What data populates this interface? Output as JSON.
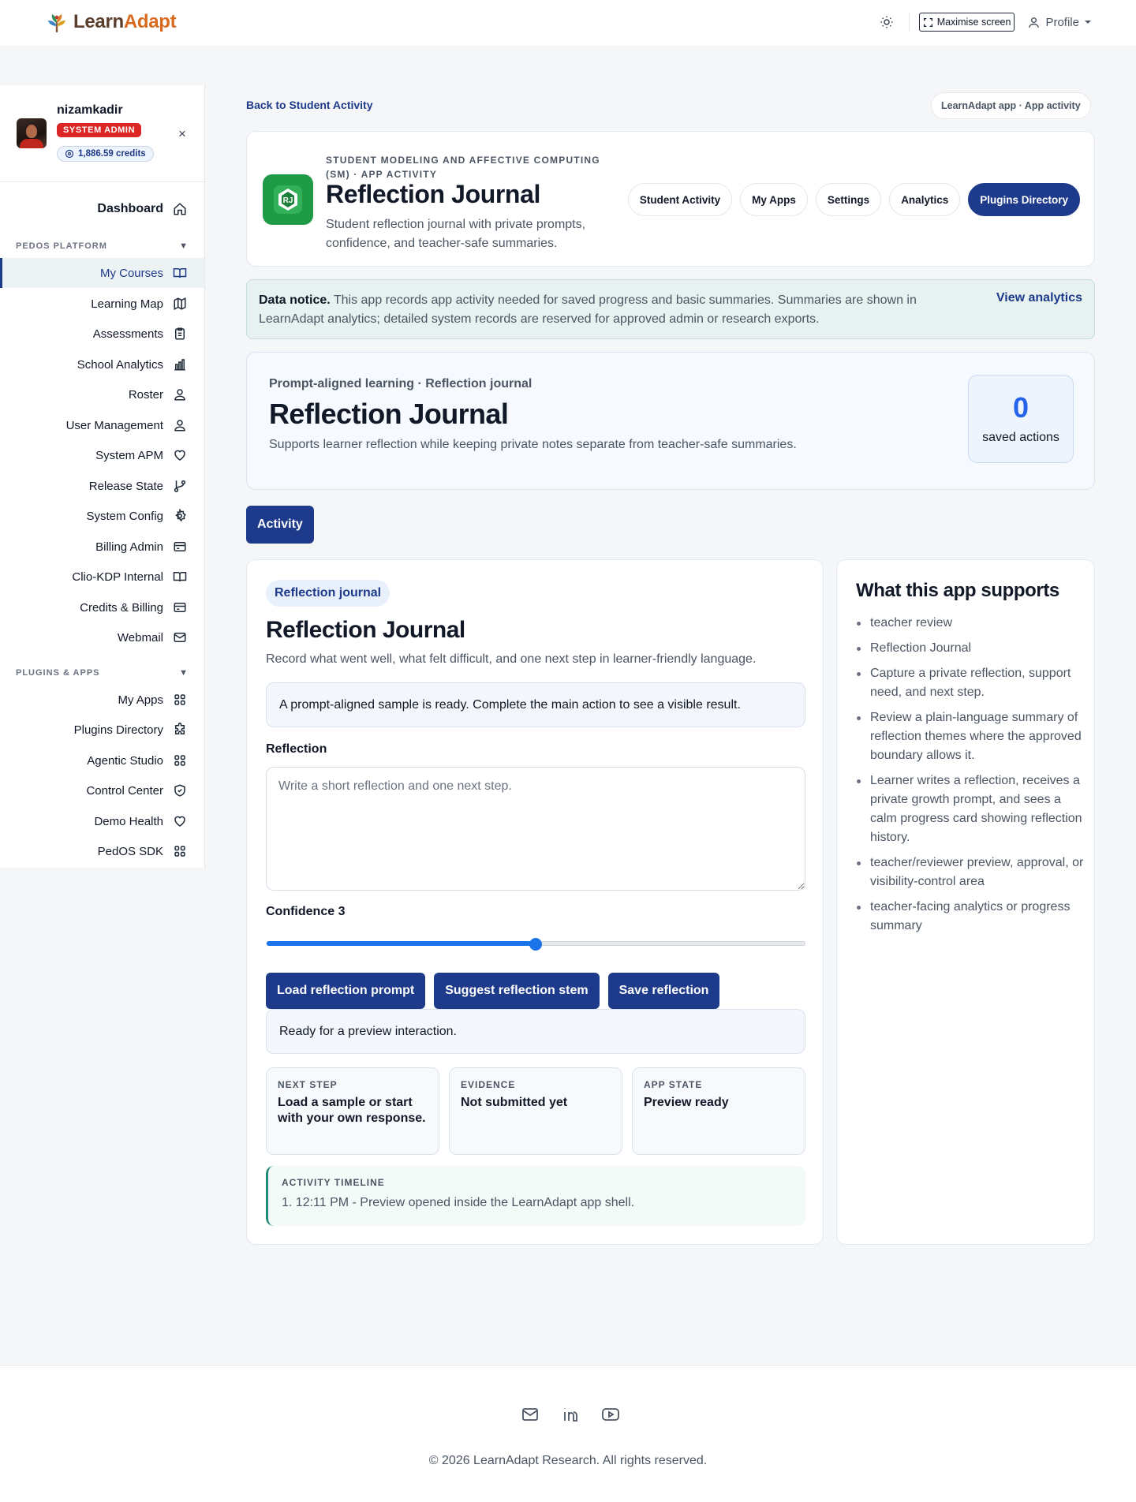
{
  "brand": {
    "name_part1": "Learn",
    "name_part2": "Adapt"
  },
  "topbar": {
    "theme_icon": "sun-icon",
    "maximise_label": "Maximise screen",
    "profile_label": "Profile"
  },
  "user": {
    "name": "nizamkadir",
    "role": "SYSTEM ADMIN",
    "credits": "1,886.59 credits",
    "close_glyph": "×"
  },
  "sidebar": {
    "dashboard": {
      "label": "Dashboard",
      "icon": "home-icon"
    },
    "sections": [
      {
        "title": "PEDOS PLATFORM",
        "caret": "▼"
      },
      {
        "title": "PLUGINS & APPS",
        "caret": "▼"
      }
    ],
    "platform_items": [
      {
        "label": "My Courses",
        "icon": "book-open-icon",
        "active": true
      },
      {
        "label": "Learning Map",
        "icon": "map-icon"
      },
      {
        "label": "Assessments",
        "icon": "clipboard-icon"
      },
      {
        "label": "School Analytics",
        "icon": "bar-chart-icon"
      },
      {
        "label": "Roster",
        "icon": "users-icon"
      },
      {
        "label": "User Management",
        "icon": "users-icon"
      },
      {
        "label": "System APM",
        "icon": "heart-icon"
      },
      {
        "label": "Release State",
        "icon": "git-branch-icon"
      },
      {
        "label": "System Config",
        "icon": "settings-icon"
      },
      {
        "label": "Billing Admin",
        "icon": "credit-card-icon"
      },
      {
        "label": "Clio-KDP Internal",
        "icon": "book-open-icon"
      },
      {
        "label": "Credits & Billing",
        "icon": "credit-card-icon"
      },
      {
        "label": "Webmail",
        "icon": "mail-icon"
      }
    ],
    "plugin_items": [
      {
        "label": "My Apps",
        "icon": "grid-icon"
      },
      {
        "label": "Plugins Directory",
        "icon": "puzzle-icon"
      },
      {
        "label": "Agentic Studio",
        "icon": "grid-icon"
      },
      {
        "label": "Control Center",
        "icon": "shield-icon"
      },
      {
        "label": "Demo Health",
        "icon": "heart-icon"
      },
      {
        "label": "PedOS SDK",
        "icon": "grid-icon"
      }
    ]
  },
  "breadcrumb": {
    "back": "Back to Student Activity",
    "context": "LearnAdapt app · App activity"
  },
  "app": {
    "logo_initials": "RJ",
    "category": "STUDENT MODELING AND AFFECTIVE COMPUTING (SM) · APP ACTIVITY",
    "title": "Reflection Journal",
    "description": "Student reflection journal with private prompts, confidence, and teacher-safe summaries.",
    "nav": [
      "Student Activity",
      "My Apps",
      "Settings",
      "Analytics",
      "Plugins Directory"
    ]
  },
  "notice": {
    "label": "Data notice.",
    "text": "This app records app activity needed for saved progress and basic summaries. Summaries are shown in LearnAdapt analytics; detailed system records are reserved for approved admin or research exports.",
    "link": "View analytics"
  },
  "hero": {
    "eyebrow": "Prompt-aligned learning · Reflection journal",
    "title": "Reflection Journal",
    "description": "Supports learner reflection while keeping private notes separate from teacher-safe summaries.",
    "stat_value": "0",
    "stat_label": "saved actions"
  },
  "tabs": {
    "activity": "Activity"
  },
  "activity": {
    "tag": "Reflection journal",
    "title": "Reflection Journal",
    "description": "Record what went well, what felt difficult, and one next step in learner-friendly language.",
    "sample_notice": "A prompt-aligned sample is ready. Complete the main action to see a visible result.",
    "reflection_label": "Reflection",
    "reflection_value": "",
    "reflection_placeholder": "Write a short reflection and one next step.",
    "confidence_label": "Confidence 3",
    "confidence_value": 3,
    "confidence_min": 1,
    "confidence_max": 5,
    "buttons": [
      "Load reflection prompt",
      "Suggest reflection stem",
      "Save reflection"
    ],
    "status": "Ready for a preview interaction.",
    "tiles": [
      {
        "label": "NEXT STEP",
        "value": "Load a sample or start with your own response."
      },
      {
        "label": "EVIDENCE",
        "value": "Not submitted yet"
      },
      {
        "label": "APP STATE",
        "value": "Preview ready"
      }
    ],
    "timeline_label": "ACTIVITY TIMELINE",
    "timeline": [
      "1. 12:11 PM - Preview opened inside the LearnAdapt app shell."
    ]
  },
  "supports": {
    "title": "What this app supports",
    "items": [
      "teacher review",
      "Reflection Journal",
      "Capture a private reflection, support need, and next step.",
      "Review a plain-language summary of reflection themes where the approved boundary allows it.",
      "Learner writes a reflection, receives a private growth prompt, and sees a calm progress card showing reflection history.",
      "teacher/reviewer preview, approval, or visibility-control area",
      "teacher-facing analytics or progress summary"
    ]
  },
  "footer": {
    "icons": [
      "mail-icon",
      "linkedin-icon",
      "youtube-icon"
    ],
    "copyright": "© 2026 LearnAdapt Research. All rights reserved."
  },
  "colors": {
    "primary": "#1e3a8a",
    "danger": "#dc2626",
    "accent_blue": "#2563eb",
    "slider": "#1a73e8",
    "logo_green": "#1f9a46",
    "brand_orange": "#d86a1f"
  }
}
